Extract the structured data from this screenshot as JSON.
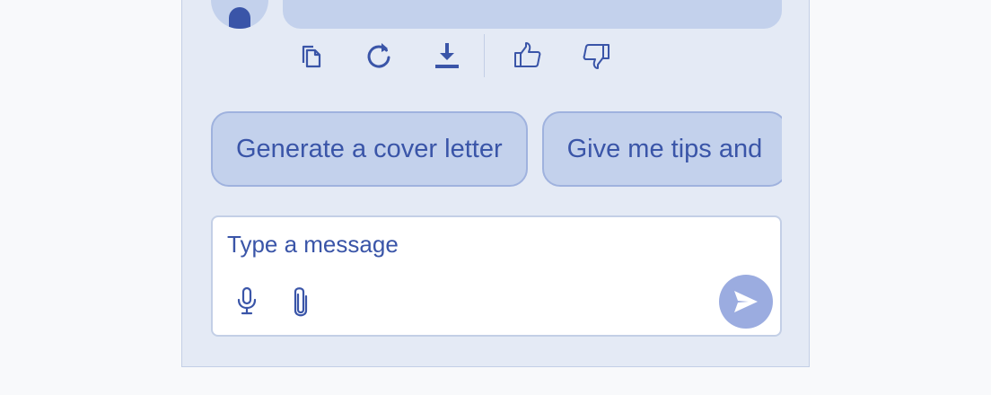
{
  "colors": {
    "accent": "#3a55a8",
    "panel_bg": "#e4eaf5",
    "bubble_bg": "#c3d1ec",
    "chip_border": "#9fb2de",
    "send_bg": "#9bace0"
  },
  "message_actions": [
    {
      "icon": "copy-icon"
    },
    {
      "icon": "regenerate-icon"
    },
    {
      "icon": "download-icon"
    },
    {
      "icon": "thumbs-up-icon"
    },
    {
      "icon": "thumbs-down-icon"
    }
  ],
  "suggestions": [
    {
      "label": "Generate a cover letter"
    },
    {
      "label": "Give me tips and"
    }
  ],
  "composer": {
    "placeholder": "Type a message",
    "value": "",
    "tools": [
      {
        "icon": "microphone-icon"
      },
      {
        "icon": "paperclip-icon"
      }
    ],
    "send_icon": "send-icon"
  }
}
